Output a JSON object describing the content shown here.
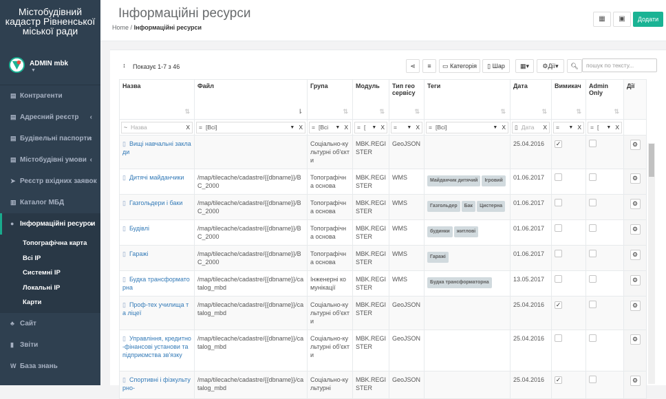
{
  "brand": "Містобудівний кадастр Рівненської міської ради",
  "user": {
    "name": "ADMIN mbk"
  },
  "nav": {
    "items": [
      {
        "label": "Контрагенти",
        "icon": "building-icon"
      },
      {
        "label": "Адресний реєстр",
        "icon": "building-icon",
        "chev": "‹"
      },
      {
        "label": "Будівельні паспорти",
        "icon": "building-icon",
        "chev": "‹"
      },
      {
        "label": "Містобудівні умови",
        "icon": "building-icon",
        "chev": "‹"
      },
      {
        "label": "Реєстр вхідних заявок",
        "icon": "paper-plane-icon"
      },
      {
        "label": "Каталог МБД",
        "icon": "catalog-icon"
      },
      {
        "label": "Інформаційні ресурси",
        "icon": "map-marker-icon",
        "chev": "‹"
      }
    ],
    "sub": [
      "Топографічна карта",
      "Всі ІР",
      "Системні ІР",
      "Локальні ІР",
      "Карти"
    ],
    "bottom": [
      {
        "label": "Сайт",
        "icon": "sitemap-icon"
      },
      {
        "label": "Звіти",
        "icon": "bar-chart-icon"
      },
      {
        "label": "База знань",
        "icon": "wikipedia-icon"
      }
    ]
  },
  "page": {
    "title": "Інформаційні ресурси",
    "crumb_home": "Home",
    "crumb_sep": "/",
    "crumb_current": "Інформаційні ресурси",
    "add_label": "Додати"
  },
  "toolbar": {
    "showing": "Показує 1-7 з 46",
    "category": "Категорія",
    "layer": "Шар",
    "actions": "Дії",
    "search_placeholder": "пошук по тексту..."
  },
  "columns": [
    "Назва",
    "Файл",
    "Група",
    "Модуль",
    "Тип гео сервісу",
    "Теги",
    "Дата",
    "Вимикач",
    "Admin Only",
    "Дії"
  ],
  "filters": {
    "name": "Назва",
    "all": "[Всі]",
    "g": "[Всі",
    "m": "[",
    "date": "Дата"
  },
  "rows": [
    {
      "name": "Вищі навчальні заклади",
      "file": "",
      "group": "Соціально-культурні об'єкти",
      "module": "MBK.REGISTER",
      "type": "GeoJSON",
      "tags": [],
      "date": "25.04.2016",
      "switch": true,
      "admin": false
    },
    {
      "name": "Дитячі майданчики",
      "file": "/map/tilecache/cadastre/{{dbname}}/BC_2000",
      "group": "Топографічна основа",
      "module": "MBK.REGISTER",
      "type": "WMS",
      "tags": [
        "Майданчик дитячий",
        "Ігровий"
      ],
      "date": "01.06.2017",
      "switch": false,
      "admin": false
    },
    {
      "name": "Газгольдери і баки",
      "file": "/map/tilecache/cadastre/{{dbname}}/BC_2000",
      "group": "Топографічна основа",
      "module": "MBK.REGISTER",
      "type": "WMS",
      "tags": [
        "Газгольдер",
        "Бак",
        "Цистерна"
      ],
      "date": "01.06.2017",
      "switch": false,
      "admin": false
    },
    {
      "name": "Будівлі",
      "file": "/map/tilecache/cadastre/{{dbname}}/BC_2000",
      "group": "Топографічна основа",
      "module": "MBK.REGISTER",
      "type": "WMS",
      "tags": [
        "будинки",
        "житлові"
      ],
      "date": "01.06.2017",
      "switch": false,
      "admin": false
    },
    {
      "name": "Гаражі",
      "file": "/map/tilecache/cadastre/{{dbname}}/BC_2000",
      "group": "Топографічна основа",
      "module": "MBK.REGISTER",
      "type": "WMS",
      "tags": [
        "Гаражі"
      ],
      "date": "01.06.2017",
      "switch": false,
      "admin": false
    },
    {
      "name": "Будка трансформаторна",
      "file": "/map/tilecache/cadastre/{{dbname}}/catalog_mbd",
      "group": "Інженерні комунікації",
      "module": "MBK.REGISTER",
      "type": "WMS",
      "tags": [
        "Будка трансформаторна"
      ],
      "date": "13.05.2017",
      "switch": false,
      "admin": false
    },
    {
      "name": "Проф-тех училища та ліцеї",
      "file": "/map/tilecache/cadastre/{{dbname}}/catalog_mbd",
      "group": "Соціально-культурні об'єкти",
      "module": "MBK.REGISTER",
      "type": "GeoJSON",
      "tags": [],
      "date": "25.04.2016",
      "switch": true,
      "admin": false
    },
    {
      "name": "Управління, кредитно-фінансові установи та підприємства зв'язку",
      "file": "/map/tilecache/cadastre/{{dbname}}/catalog_mbd",
      "group": "Соціально-культурні об'єкти",
      "module": "MBK.REGISTER",
      "type": "GeoJSON",
      "tags": [],
      "date": "25.04.2016",
      "switch": false,
      "admin": false
    },
    {
      "name": "Спортивні і фізкультурно-",
      "file": "/map/tilecache/cadastre/{{dbname}}/catalog_mbd",
      "group": "Соціально-культурні",
      "module": "MBK.REGISTER",
      "type": "GeoJSON",
      "tags": [],
      "date": "25.04.2016",
      "switch": true,
      "admin": false
    }
  ]
}
